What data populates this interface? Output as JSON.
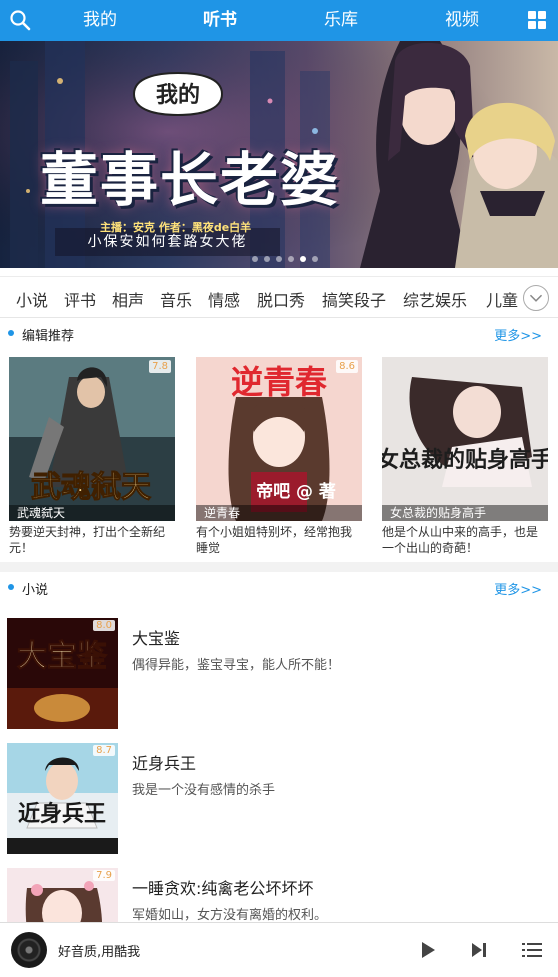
{
  "nav": {
    "tabs": [
      {
        "label": "我的",
        "active": false
      },
      {
        "label": "听书",
        "active": true
      },
      {
        "label": "乐库",
        "active": false
      },
      {
        "label": "视频",
        "active": false
      }
    ],
    "accent": "#1f95e6"
  },
  "banner": {
    "title_small": "我的",
    "title_big": "董事长老婆",
    "subtitle": "小保安如何套路女大佬",
    "credits": "主播：安克    作者：黑夜de白羊",
    "dots": 6,
    "active_dot": 5
  },
  "categories": [
    "小说",
    "评书",
    "相声",
    "音乐",
    "情感",
    "脱口秀",
    "搞笑段子",
    "综艺娱乐",
    "儿童"
  ],
  "editor_section": {
    "title": "编辑推荐",
    "more": "更多>>",
    "cards": [
      {
        "score": "7.8",
        "cover_text": "武魂弑天",
        "caption": "武魂弑天",
        "desc": "势要逆天封神，打出个全新纪元！"
      },
      {
        "score": "8.6",
        "cover_text": "逆青春",
        "cover_sub": "帝吧 @ 著",
        "caption": "逆青春",
        "desc": "有个小姐姐特别坏，经常抱我睡觉"
      },
      {
        "score": "",
        "cover_text": "女总裁的贴身高手",
        "caption": "女总裁的贴身高手",
        "desc": "他是个从山中来的高手，也是一个出山的奇葩！"
      }
    ]
  },
  "novel_section": {
    "title": "小说",
    "more": "更多>>",
    "items": [
      {
        "score": "8.0",
        "cover_text": "大宝鉴",
        "name": "大宝鉴",
        "intro": "偶得异能，鉴宝寻宝，能人所不能！"
      },
      {
        "score": "8.7",
        "cover_text": "近身兵王",
        "name": "近身兵王",
        "intro": "我是一个没有感情的杀手"
      },
      {
        "score": "7.9",
        "cover_text": "",
        "name": "一睡贪欢:纯禽老公坏坏坏",
        "intro": "军婚如山，女方没有离婚的权利。"
      }
    ]
  },
  "player": {
    "label": "好音质,用酷我"
  }
}
